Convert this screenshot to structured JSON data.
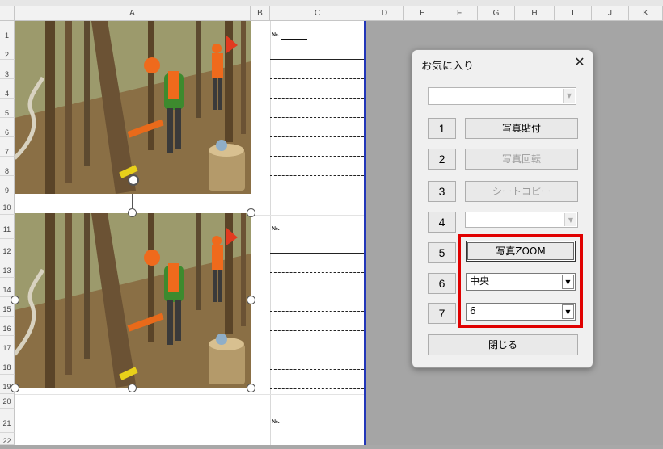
{
  "columns": [
    "A",
    "B",
    "C",
    "D",
    "E",
    "F",
    "G",
    "H",
    "I",
    "J",
    "K"
  ],
  "rows": [
    "1",
    "2",
    "3",
    "4",
    "5",
    "6",
    "7",
    "8",
    "9",
    "10",
    "11",
    "12",
    "13",
    "14",
    "15",
    "16",
    "17",
    "18",
    "19",
    "20",
    "21",
    "22"
  ],
  "sheet": {
    "no_label_1": "№.",
    "no_label_2": "№.",
    "no_label_3": "№."
  },
  "dialog": {
    "title": "お気に入り",
    "close_glyph": "✕",
    "top_combo_value": "",
    "combo_arrow": "▼",
    "buttons": [
      {
        "num": "1",
        "label": "写真貼付",
        "enabled": true
      },
      {
        "num": "2",
        "label": "写真回転",
        "enabled": false
      },
      {
        "num": "3",
        "label": "シートコピー",
        "enabled": false
      },
      {
        "num": "4",
        "label": "",
        "enabled": false
      },
      {
        "num": "5",
        "label": "写真ZOOM",
        "enabled": true
      },
      {
        "num": "6",
        "label": "中央",
        "enabled": true
      },
      {
        "num": "7",
        "label": "6",
        "enabled": true
      }
    ],
    "close_label": "閉じる"
  },
  "colors": {
    "highlight": "#e00000",
    "selection_border": "#2236b8",
    "flag": "#e23a1f",
    "vest": "#ef6a1c",
    "jacket": "#3d8a2e"
  }
}
